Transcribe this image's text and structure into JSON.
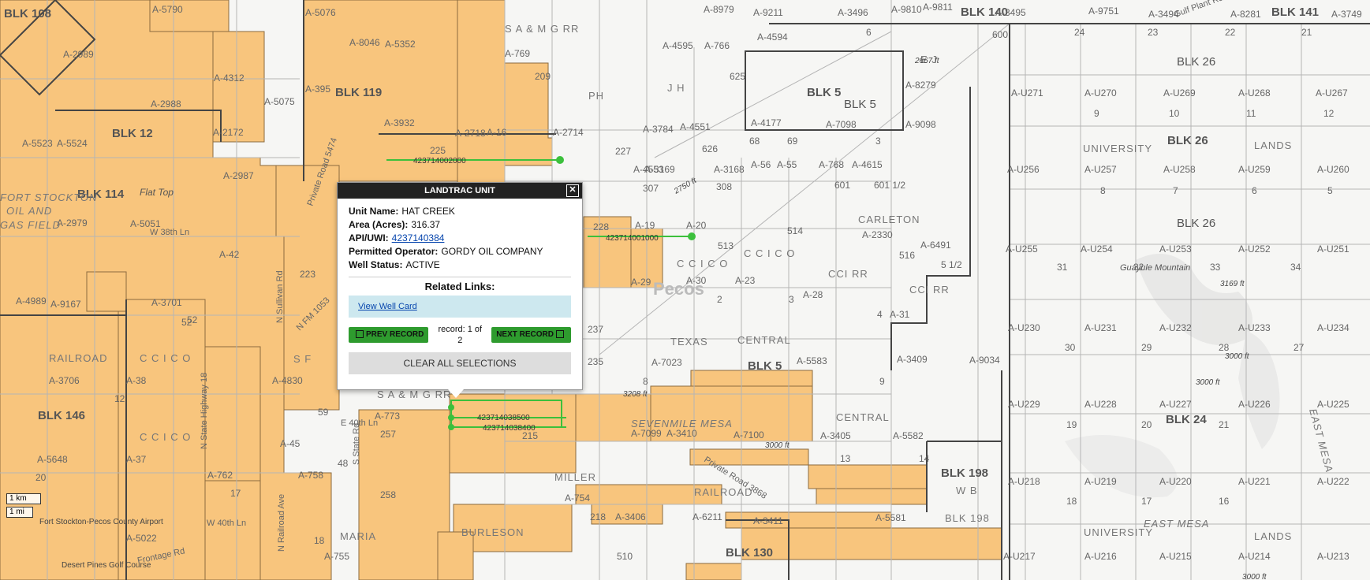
{
  "map": {
    "blocks": [
      "BLK 108",
      "BLK 12",
      "BLK 114",
      "BLK 119",
      "BLK 5",
      "BLK 5",
      "BLK 140",
      "BLK 141",
      "BLK 26",
      "BLK 26",
      "BLK 26",
      "BLK 146",
      "BLK 5",
      "BLK 198",
      "BLK 24",
      "BLK 130"
    ],
    "abstracts": [
      "A-5790",
      "A-5076",
      "A-8979",
      "A-9211",
      "A-3496",
      "A-9810",
      "A-9811",
      "A-3495",
      "A-9751",
      "A-3494",
      "A-8281",
      "A-3749",
      "A-2989",
      "A-8046",
      "A-5352",
      "A-769",
      "A-4595",
      "A-766",
      "A-4594",
      "A-8279",
      "A-4312",
      "A-5075",
      "A-395",
      "A-3932",
      "A-2718",
      "A-16",
      "A-2988",
      "A-2172",
      "A-2714",
      "A-3784",
      "A-4551",
      "A-4177",
      "A-7098",
      "A-9098",
      "A-U271",
      "A-U270",
      "A-U269",
      "A-U268",
      "A-U267",
      "A-5523",
      "A-5524",
      "A-2979",
      "A-4553",
      "A-3169",
      "A-3168",
      "A-56",
      "A-55",
      "A-768",
      "A-4615",
      "A-U256",
      "A-U257",
      "A-U258",
      "A-U259",
      "A-U260",
      "A-5051",
      "A-2987",
      "A-19",
      "A-20",
      "A-2330",
      "A-6491",
      "A-42",
      "A-29",
      "A-30",
      "A-23",
      "A-U255",
      "A-U254",
      "A-U253",
      "A-U252",
      "A-U251",
      "A-4989",
      "A-9167",
      "A-3701",
      "A-28",
      "A-31",
      "A-3706",
      "A-38",
      "A-4830",
      "A-7023",
      "A-3409",
      "A-5583",
      "A-9034",
      "A-U230",
      "A-U231",
      "A-U232",
      "A-U233",
      "A-U234",
      "A-773",
      "A-3405",
      "A-5582",
      "A-U229",
      "A-U228",
      "A-U227",
      "A-U226",
      "A-U225",
      "A-5648",
      "A-37",
      "A-45",
      "A-758",
      "A-3406",
      "A-6211",
      "A-5581",
      "A-U218",
      "A-U219",
      "A-U220",
      "A-U221",
      "A-U222",
      "A-762",
      "A-754",
      "A-5022",
      "A-755",
      "A-3411",
      "A-U217",
      "A-U216",
      "A-U215",
      "A-U214",
      "A-U213",
      "A-7099",
      "A-3410",
      "A-7100"
    ],
    "places": [
      "FORT STOCKTON",
      "OIL AND",
      "GAS FIELD",
      "RAILROAD",
      "C C I C O",
      "C C I C O",
      "S A & M G RR",
      "S A & M G RR",
      "S F",
      "PH",
      "J H",
      "E J",
      "UNIVERSITY",
      "LANDS",
      "UNIVERSITY",
      "LANDS",
      "CARLETON",
      "CCI RR",
      "CCI RR",
      "C C I C O",
      "C C I C O",
      "TEXAS",
      "CENTRAL",
      "CENTRAL",
      "SEVENMILE MESA",
      "MILLER",
      "RAILROAD",
      "W B",
      "BLK 198",
      "BURLESON",
      "MARIA",
      "EAST MESA",
      "EAST MESA",
      "Pecos",
      "Flat Top",
      "Guayule Mountain",
      "Fort Stockton-Pecos County Airport",
      "Desert Pines Golf Course"
    ],
    "roads": [
      "Private Road 5474",
      "N Sullivan Rd",
      "N FM 1053",
      "N State Highway 18",
      "S State Rd",
      "E 40th Ln",
      "W 40th Ln",
      "W 38th Ln",
      "N Railroad Ave",
      "Private Road 3868",
      "Frontage Rd",
      "Gulf Plant Rd"
    ],
    "elevations": [
      "2667 ft",
      "3169 ft",
      "3208 ft",
      "3000 ft",
      "3000 ft",
      "3000 ft",
      "3000 ft",
      "2750 ft"
    ],
    "wells": [
      "423714002000",
      "423714001000",
      "423714038500",
      "423714038400"
    ],
    "scale": {
      "km": "1 km",
      "mi": "1 mi"
    },
    "numbers": [
      "6",
      "600",
      "24",
      "23",
      "22",
      "21",
      "625",
      "9",
      "10",
      "11",
      "12",
      "68",
      "69",
      "3",
      "227",
      "626",
      "307",
      "308",
      "601",
      "601 1/2",
      "8",
      "7",
      "6",
      "5",
      "514",
      "516",
      "513",
      "5 1/2",
      "31",
      "32",
      "33",
      "34",
      "223",
      "2",
      "3",
      "4",
      "30",
      "29",
      "28",
      "27",
      "228",
      "225",
      "209",
      "237",
      "235",
      "52",
      "20",
      "12",
      "13",
      "14",
      "19",
      "20",
      "21",
      "8",
      "9",
      "257",
      "215",
      "18",
      "17",
      "16",
      "258",
      "218",
      "510",
      "17",
      "18",
      "48",
      "52",
      "59"
    ]
  },
  "colors": {
    "lease_fill": "#f8c57d",
    "lease_stroke": "#8b6a3e",
    "selected": "#3cc03c",
    "survey_line": "#aaaaaa",
    "block_line": "#444444"
  },
  "popup": {
    "title": "LANDTRAC UNIT",
    "close": "✕",
    "fields": [
      {
        "label": "Unit Name:",
        "value": "HAT CREEK"
      },
      {
        "label": "Area (Acres):",
        "value": "316.37"
      },
      {
        "label": "API/UWI:",
        "value": "4237140384"
      },
      {
        "label": "Permitted Operator:",
        "value": "GORDY OIL COMPANY"
      },
      {
        "label": "Well Status:",
        "value": "ACTIVE"
      }
    ],
    "related_links_title": "Related Links:",
    "well_card_link": "View Well Card",
    "prev_record": "PREV RECORD",
    "next_record": "NEXT RECORD",
    "record_text": "record: 1 of",
    "record_total": "2",
    "clear_all": "CLEAR ALL SELECTIONS"
  }
}
